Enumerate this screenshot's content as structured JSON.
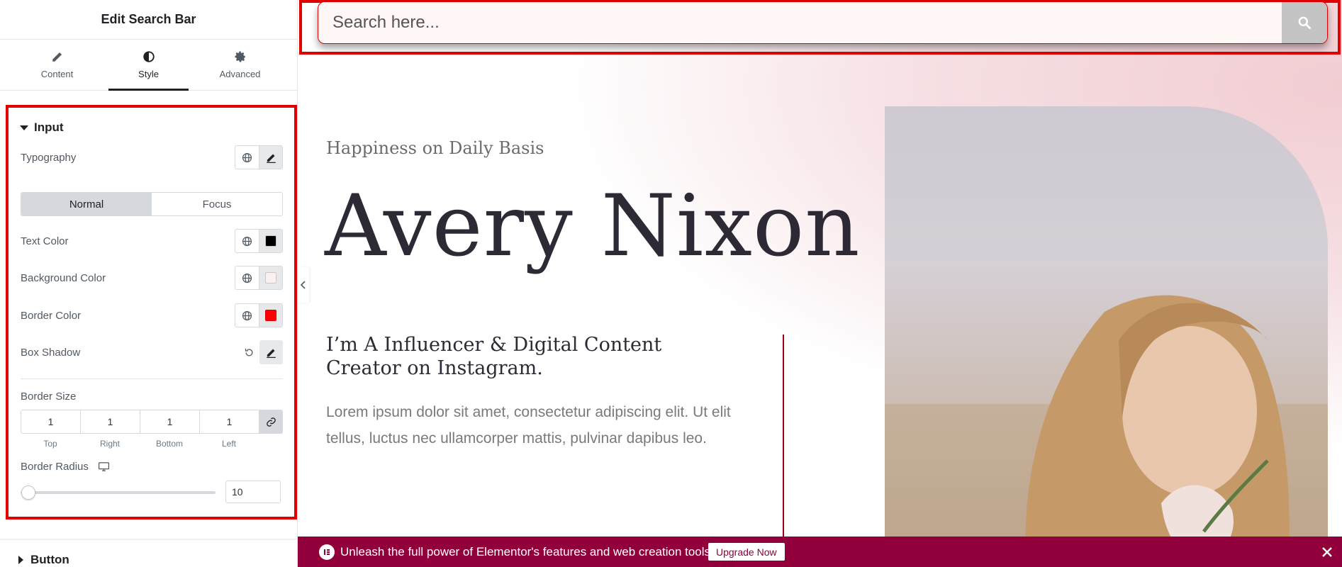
{
  "panel": {
    "title": "Edit Search Bar",
    "tabs": [
      {
        "label": "Content",
        "icon": "pencil-icon",
        "active": false
      },
      {
        "label": "Style",
        "icon": "contrast-icon",
        "active": true
      },
      {
        "label": "Advanced",
        "icon": "gear-icon",
        "active": false
      }
    ],
    "input_section": {
      "heading": "Input",
      "typography_label": "Typography",
      "states": {
        "normal": "Normal",
        "focus": "Focus",
        "active": "Normal"
      },
      "text_color": {
        "label": "Text Color",
        "value": "#000000"
      },
      "background_color": {
        "label": "Background Color",
        "value": "#fbf1f1"
      },
      "border_color": {
        "label": "Border Color",
        "value": "#ff0000"
      },
      "box_shadow_label": "Box Shadow",
      "border_size": {
        "label": "Border Size",
        "top": "1",
        "right": "1",
        "bottom": "1",
        "left": "1",
        "caps": [
          "Top",
          "Right",
          "Bottom",
          "Left"
        ]
      },
      "border_radius": {
        "label": "Border Radius",
        "value": "10",
        "slider_fraction": 0.03
      }
    },
    "button_section": {
      "heading": "Button"
    }
  },
  "preview": {
    "search": {
      "placeholder": "Search here..."
    },
    "tagline": "Happiness on Daily Basis",
    "name": "Avery Nixon",
    "subhead": "I’m A Influencer & Digital Content Creator on Instagram.",
    "body": "Lorem ipsum dolor sit amet, consectetur adipiscing elit. Ut elit tellus, luctus nec ullamcorper mattis, pulvinar dapibus leo."
  },
  "notice": {
    "text": "Unleash the full power of Elementor's features and web creation tools.",
    "button": "Upgrade Now"
  },
  "colors": {
    "highlight": "#e00000",
    "notice_bg": "#92003b",
    "accent_line": "#a0001c"
  }
}
